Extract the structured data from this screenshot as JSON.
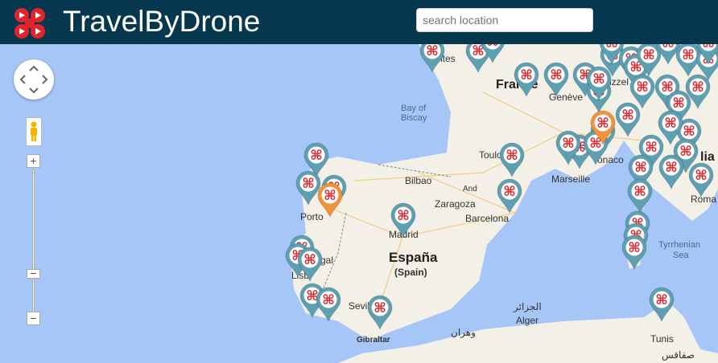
{
  "header": {
    "title": "TravelByDrone",
    "search_placeholder": "search location",
    "logo": "drone-logo"
  },
  "map": {
    "labels": {
      "france": "France",
      "espana": "España",
      "spain": "(Spain)",
      "bay1": "Bay of",
      "bay2": "Biscay",
      "bilbao": "Bilbao",
      "porto": "Porto",
      "madrid": "Madrid",
      "zaragoza": "Zaragoza",
      "barcelona": "Barcelona",
      "toulouse": "Toulo",
      "marseille": "Marseille",
      "geneve": "Genève",
      "monaco": "onaco",
      "lisboa": "Lisb",
      "gal": "gal",
      "sevilla": "Sevil",
      "gibraltar": "Gibraltar",
      "alger": "Alger",
      "alger_ar": "الجزائر",
      "oran_ar": "وهران",
      "tyrr1": "Tyrrhenian",
      "tyrr2": "Sea",
      "tunis": "Tunis",
      "sfax_ar": "صفاقس",
      "italia": "lia",
      "roma": "Roma",
      "andorra": "And",
      "nantes": "ntes",
      "zurich": "izzel"
    },
    "marker_colors": {
      "default": "#5e9fb1",
      "selected": "#f0933a",
      "symbol": "#e3232b"
    },
    "controls": {
      "zoom_in": "+",
      "zoom_out": "−",
      "pegman": "pegman-icon",
      "pan": "pan-control"
    }
  }
}
